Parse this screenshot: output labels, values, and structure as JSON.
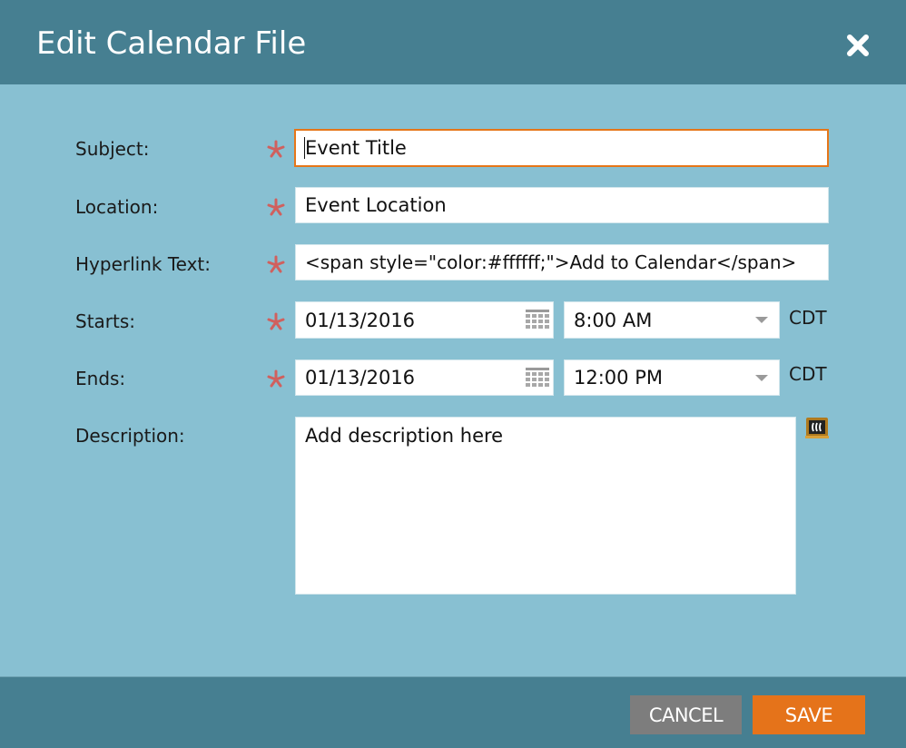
{
  "dialog": {
    "title": "Edit Calendar File",
    "close_icon": "close-icon"
  },
  "form": {
    "subject": {
      "label": "Subject:",
      "required": true,
      "value": "Event Title",
      "focused": true
    },
    "location": {
      "label": "Location:",
      "required": true,
      "value": "Event Location"
    },
    "hyperlink_text": {
      "label": "Hyperlink Text:",
      "required": true,
      "value": "<span style=\"color:#ffffff;\">Add to Calendar</span>"
    },
    "starts": {
      "label": "Starts:",
      "required": true,
      "date": "01/13/2016",
      "time": "8:00 AM",
      "timezone": "CDT"
    },
    "ends": {
      "label": "Ends:",
      "required": true,
      "date": "01/13/2016",
      "time": "12:00 PM",
      "timezone": "CDT"
    },
    "description": {
      "label": "Description:",
      "value": "Add description here",
      "editor_icon": "rich-text-editor-icon"
    }
  },
  "footer": {
    "cancel_label": "CANCEL",
    "save_label": "SAVE"
  },
  "colors": {
    "header_bg": "#467f91",
    "body_bg": "#88c0d2",
    "required_asterisk": "#d0605e",
    "focus_border": "#e67619",
    "cancel_bg": "#7d7d7d",
    "save_bg": "#e5731a"
  }
}
